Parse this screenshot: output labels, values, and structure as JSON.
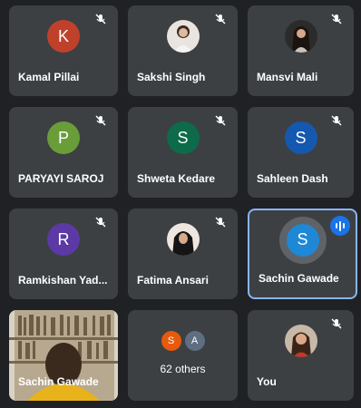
{
  "participants": [
    {
      "name": "Kamal Pillai",
      "initial": "K",
      "color": "#c0412b"
    },
    {
      "name": "Sakshi Singh",
      "photo": "sakshi-photo"
    },
    {
      "name": "Mansvi Mali",
      "photo": "mansvi-photo"
    },
    {
      "name": "PARYAYI SAROJ",
      "initial": "P",
      "color": "#6a9d3a"
    },
    {
      "name": "Shweta Kedare",
      "initial": "S",
      "color": "#0d6b4a"
    },
    {
      "name": "Sahleen Dash",
      "initial": "S",
      "color": "#1558b0"
    },
    {
      "name": "Ramkishan Yad...",
      "initial": "R",
      "color": "#5b3aa5"
    },
    {
      "name": "Fatima Ansari",
      "photo": "fatima-photo"
    },
    {
      "name": "Sachin Gawade",
      "initial": "S",
      "color": "#1e88d6",
      "speaking": true
    }
  ],
  "video_tile": {
    "name": "Sachin Gawade"
  },
  "others": {
    "label": "62 others",
    "avatars": [
      {
        "initial": "S",
        "color": "#e8590c"
      },
      {
        "initial": "A",
        "color": "#5f6e80"
      }
    ]
  },
  "self": {
    "name": "You"
  }
}
